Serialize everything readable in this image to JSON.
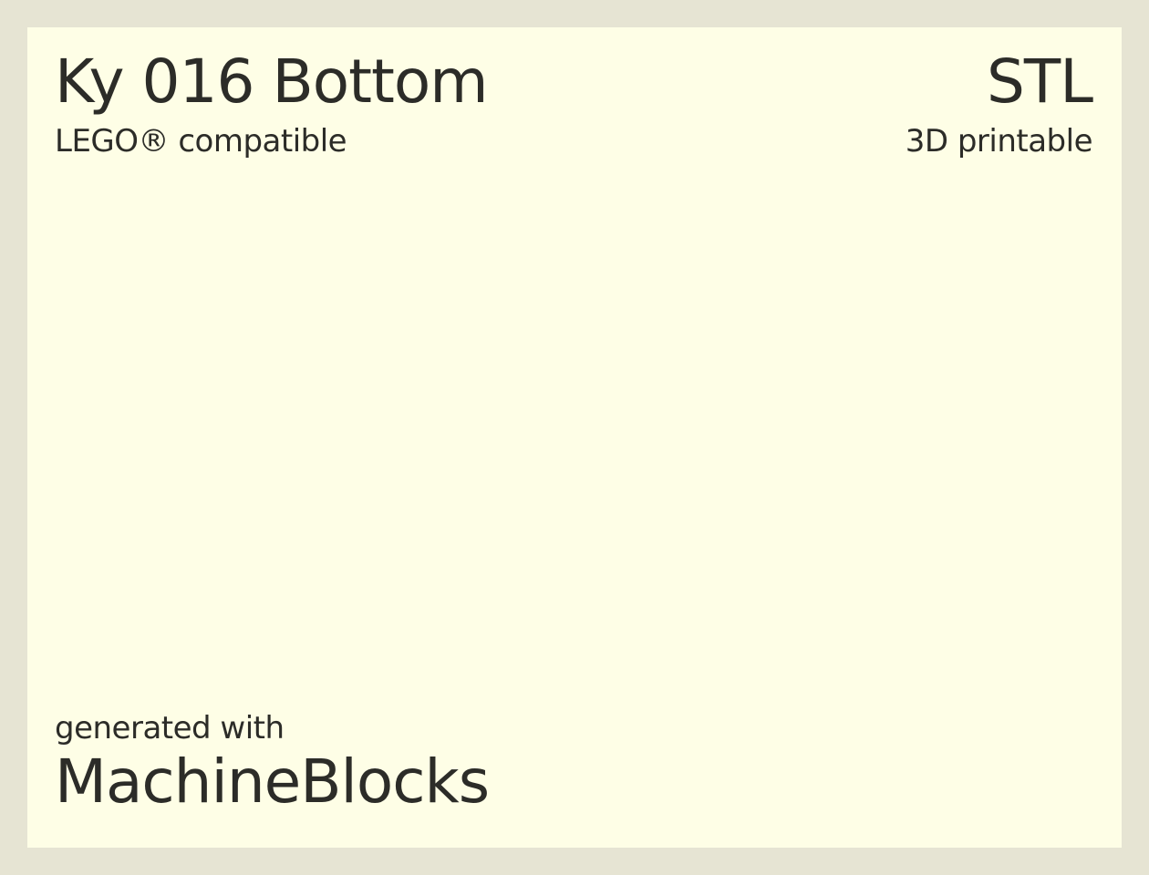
{
  "header": {
    "title": "Ky 016 Bottom",
    "subtitle": "LEGO® compatible",
    "format": "STL",
    "format_subtitle": "3D printable"
  },
  "footer": {
    "generated_label": "generated with",
    "brand": "MachineBlocks"
  },
  "colors": {
    "background": "#e6e4d3",
    "card": "#fefee6",
    "text": "#2c2c28"
  }
}
